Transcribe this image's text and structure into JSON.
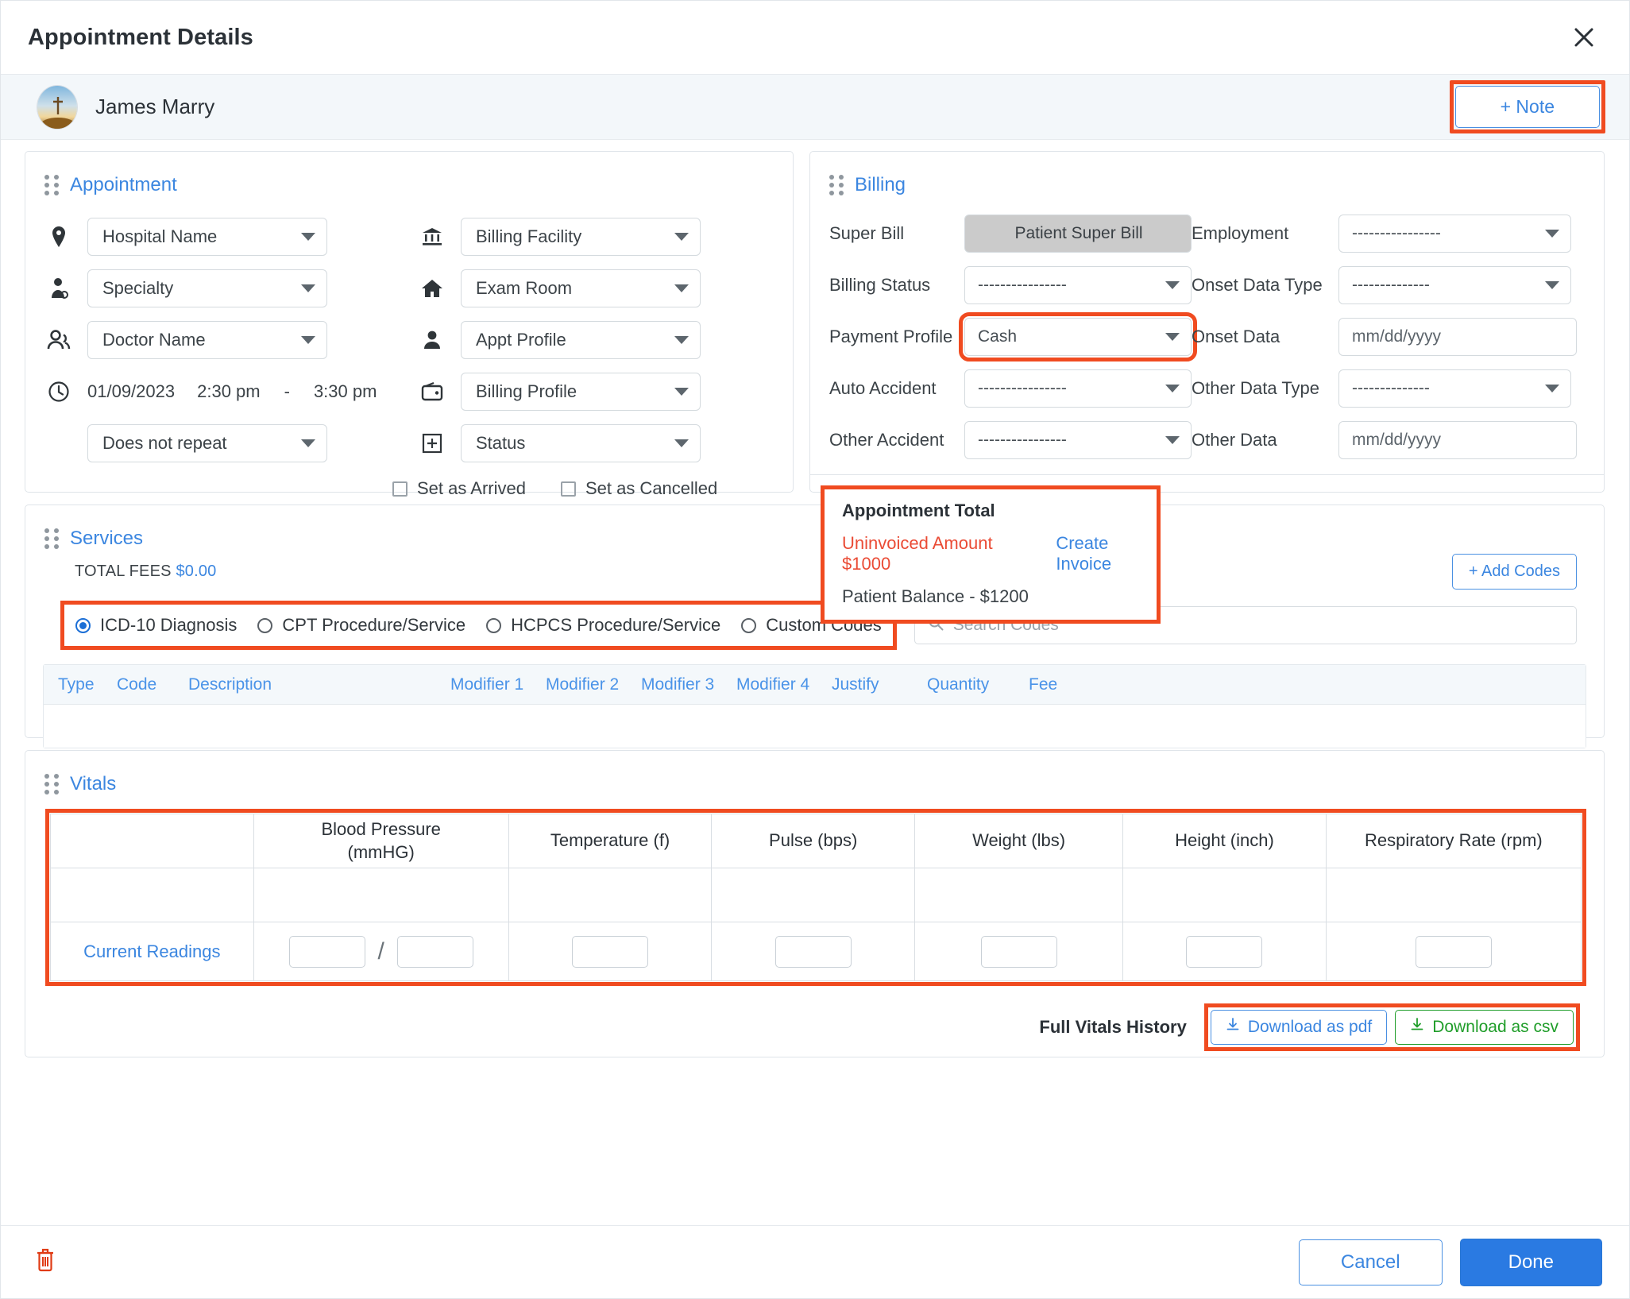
{
  "header": {
    "title": "Appointment Details",
    "close_icon": "close-icon"
  },
  "patient_bar": {
    "name": "James Marry",
    "note_button": "+ Note"
  },
  "appointment": {
    "section_title": "Appointment",
    "left_fields": [
      {
        "icon": "location-pin-icon",
        "value": "Hospital Name"
      },
      {
        "icon": "doctor-icon",
        "value": "Specialty"
      },
      {
        "icon": "people-icon",
        "value": "Doctor Name"
      }
    ],
    "datetime": {
      "icon": "clock-icon",
      "date": "01/09/2023",
      "start_time": "2:30 pm",
      "separator": "-",
      "end_time": "3:30 pm"
    },
    "repeat": "Does not repeat",
    "right_fields": [
      {
        "icon": "bank-icon",
        "value": "Billing Facility"
      },
      {
        "icon": "home-icon",
        "value": "Exam Room"
      },
      {
        "icon": "person-icon",
        "value": "Appt Profile"
      },
      {
        "icon": "wallet-icon",
        "value": "Billing Profile"
      },
      {
        "icon": "plus-box-icon",
        "value": "Status"
      }
    ],
    "checkboxes": [
      {
        "label": "Set as Arrived",
        "checked": false
      },
      {
        "label": "Set as Cancelled",
        "checked": false
      }
    ]
  },
  "billing": {
    "section_title": "Billing",
    "left_fields": [
      {
        "label": "Super Bill",
        "value": "Patient Super Bill",
        "type": "button"
      },
      {
        "label": "Billing Status",
        "value": "----------------",
        "type": "select"
      },
      {
        "label": "Payment Profile",
        "value": "Cash",
        "type": "select",
        "highlight": true
      },
      {
        "label": "Auto Accident",
        "value": "----------------",
        "type": "select"
      },
      {
        "label": "Other Accident",
        "value": "----------------",
        "type": "select"
      }
    ],
    "right_fields": [
      {
        "label": "Employment",
        "value": "----------------",
        "type": "select"
      },
      {
        "label": "Onset Data Type",
        "value": "--------------",
        "type": "select"
      },
      {
        "label": "Onset Data",
        "value": "mm/dd/yyyy",
        "type": "input"
      },
      {
        "label": "Other Data Type",
        "value": "--------------",
        "type": "select"
      },
      {
        "label": "Other Data",
        "value": "mm/dd/yyyy",
        "type": "input"
      }
    ],
    "total": {
      "title": "Appointment Total",
      "uninvoiced": "Uninvoiced Amount $1000",
      "create_invoice": "Create Invoice",
      "patient_balance": "Patient Balance - $1200"
    }
  },
  "services": {
    "section_title": "Services",
    "total_fees_label": "TOTAL FEES",
    "total_fees_amount": "$0.00",
    "add_codes_button": "+ Add Codes",
    "code_types": [
      {
        "label": "ICD-10 Diagnosis",
        "selected": true
      },
      {
        "label": "CPT Procedure/Service",
        "selected": false
      },
      {
        "label": "HCPCS Procedure/Service",
        "selected": false
      },
      {
        "label": "Custom Codes",
        "selected": false
      }
    ],
    "search_placeholder": "Search Codes",
    "search_value": "",
    "search_icon": "search-icon",
    "table_headers": [
      "Type",
      "Code",
      "Description",
      "Modifier 1",
      "Modifier 2",
      "Modifier 3",
      "Modifier 4",
      "Justify",
      "Quantity",
      "Fee"
    ],
    "table_rows": []
  },
  "vitals": {
    "section_title": "Vitals",
    "columns": [
      "",
      "Blood Pressure (mmHG)",
      "Temperature (f)",
      "Pulse (bps)",
      "Weight (lbs)",
      "Height (inch)",
      "Respiratory Rate (rpm)"
    ],
    "column_lines": [
      [
        "",
        ""
      ],
      [
        "Blood Pressure",
        "(mmHG)"
      ],
      [
        "Temperature (f)",
        ""
      ],
      [
        "Pulse (bps)",
        ""
      ],
      [
        "Weight (lbs)",
        ""
      ],
      [
        "Height (inch)",
        ""
      ],
      [
        "Respiratory Rate (rpm)",
        ""
      ]
    ],
    "row_label": "Current Readings",
    "values": {
      "bp_systolic": "",
      "bp_diastolic": "",
      "temperature": "",
      "pulse": "",
      "weight": "",
      "height": "",
      "respiratory_rate": ""
    },
    "bp_separator": "/",
    "history_label": "Full Vitals History",
    "download_pdf": "Download as pdf",
    "download_csv": "Download as csv",
    "download_icon": "download-icon"
  },
  "footer": {
    "delete_icon": "trash-icon",
    "cancel": "Cancel",
    "done": "Done"
  },
  "colors": {
    "accent_blue": "#3b86e0",
    "highlight_red": "#f04b20",
    "uninvoiced_red": "#ea4b35",
    "csv_green": "#1f9d29",
    "done_blue": "#2a7ae2"
  }
}
